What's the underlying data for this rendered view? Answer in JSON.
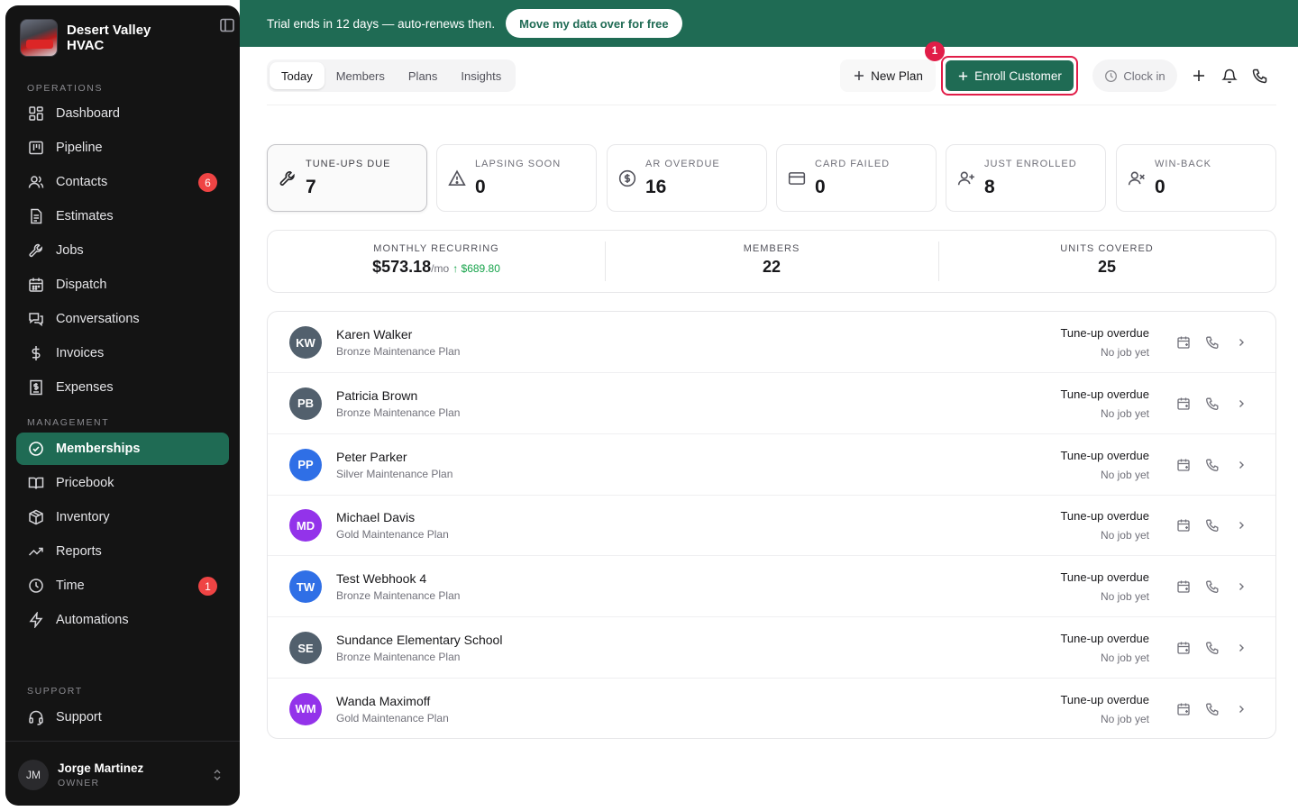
{
  "sidebar": {
    "company": "Desert Valley HVAC",
    "sections": {
      "operations": "OPERATIONS",
      "management": "MANAGEMENT",
      "support": "SUPPORT"
    },
    "items": [
      {
        "label": "Dashboard",
        "icon": "dashboard-icon"
      },
      {
        "label": "Pipeline",
        "icon": "pipeline-icon"
      },
      {
        "label": "Contacts",
        "icon": "contacts-icon",
        "badge": "6"
      },
      {
        "label": "Estimates",
        "icon": "estimates-icon"
      },
      {
        "label": "Jobs",
        "icon": "wrench-icon"
      },
      {
        "label": "Dispatch",
        "icon": "calendar-icon"
      },
      {
        "label": "Conversations",
        "icon": "chat-icon"
      },
      {
        "label": "Invoices",
        "icon": "dollar-icon"
      },
      {
        "label": "Expenses",
        "icon": "receipt-icon"
      },
      {
        "label": "Memberships",
        "icon": "check-circle-icon",
        "active": true
      },
      {
        "label": "Pricebook",
        "icon": "book-icon"
      },
      {
        "label": "Inventory",
        "icon": "box-icon"
      },
      {
        "label": "Reports",
        "icon": "trend-icon"
      },
      {
        "label": "Time",
        "icon": "clock-icon",
        "badge": "1"
      },
      {
        "label": "Automations",
        "icon": "bolt-icon"
      },
      {
        "label": "Support",
        "icon": "headset-icon"
      }
    ],
    "user": {
      "initials": "JM",
      "name": "Jorge Martinez",
      "role": "OWNER"
    }
  },
  "banner": {
    "text": "Trial ends in 12 days — auto-renews then.",
    "button": "Move my data over for free"
  },
  "toolbar": {
    "tabs": [
      "Today",
      "Members",
      "Plans",
      "Insights"
    ],
    "active_tab": "Today",
    "new_plan": "New Plan",
    "enroll": "Enroll Customer",
    "marker": "1",
    "clock_in": "Clock in"
  },
  "stats": [
    {
      "label": "TUNE-UPS DUE",
      "value": "7",
      "icon": "wrench-icon"
    },
    {
      "label": "LAPSING SOON",
      "value": "0",
      "icon": "warning-icon"
    },
    {
      "label": "AR OVERDUE",
      "value": "16",
      "icon": "dollar-circle-icon"
    },
    {
      "label": "CARD FAILED",
      "value": "0",
      "icon": "credit-card-icon"
    },
    {
      "label": "JUST ENROLLED",
      "value": "8",
      "icon": "user-plus-icon"
    },
    {
      "label": "WIN-BACK",
      "value": "0",
      "icon": "user-x-icon"
    }
  ],
  "summary": {
    "mrr_label": "MONTHLY RECURRING",
    "mrr_value": "$573.18",
    "mrr_unit": "/mo",
    "mrr_delta": "↑ $689.80",
    "members_label": "MEMBERS",
    "members_value": "22",
    "units_label": "UNITS COVERED",
    "units_value": "25"
  },
  "members": [
    {
      "initials": "KW",
      "name": "Karen Walker",
      "plan": "Bronze Maintenance Plan",
      "status": "Tune-up overdue",
      "sub": "No job yet",
      "color": "#52606d"
    },
    {
      "initials": "PB",
      "name": "Patricia Brown",
      "plan": "Bronze Maintenance Plan",
      "status": "Tune-up overdue",
      "sub": "No job yet",
      "color": "#52606d"
    },
    {
      "initials": "PP",
      "name": "Peter Parker",
      "plan": "Silver Maintenance Plan",
      "status": "Tune-up overdue",
      "sub": "No job yet",
      "color": "#2f6fe6"
    },
    {
      "initials": "MD",
      "name": "Michael Davis",
      "plan": "Gold Maintenance Plan",
      "status": "Tune-up overdue",
      "sub": "No job yet",
      "color": "#9333ea"
    },
    {
      "initials": "TW",
      "name": "Test Webhook 4",
      "plan": "Bronze Maintenance Plan",
      "status": "Tune-up overdue",
      "sub": "No job yet",
      "color": "#2f6fe6"
    },
    {
      "initials": "SE",
      "name": "Sundance Elementary School",
      "plan": "Bronze Maintenance Plan",
      "status": "Tune-up overdue",
      "sub": "No job yet",
      "color": "#52606d"
    },
    {
      "initials": "WM",
      "name": "Wanda Maximoff",
      "plan": "Gold Maintenance Plan",
      "status": "Tune-up overdue",
      "sub": "No job yet",
      "color": "#9333ea"
    }
  ]
}
